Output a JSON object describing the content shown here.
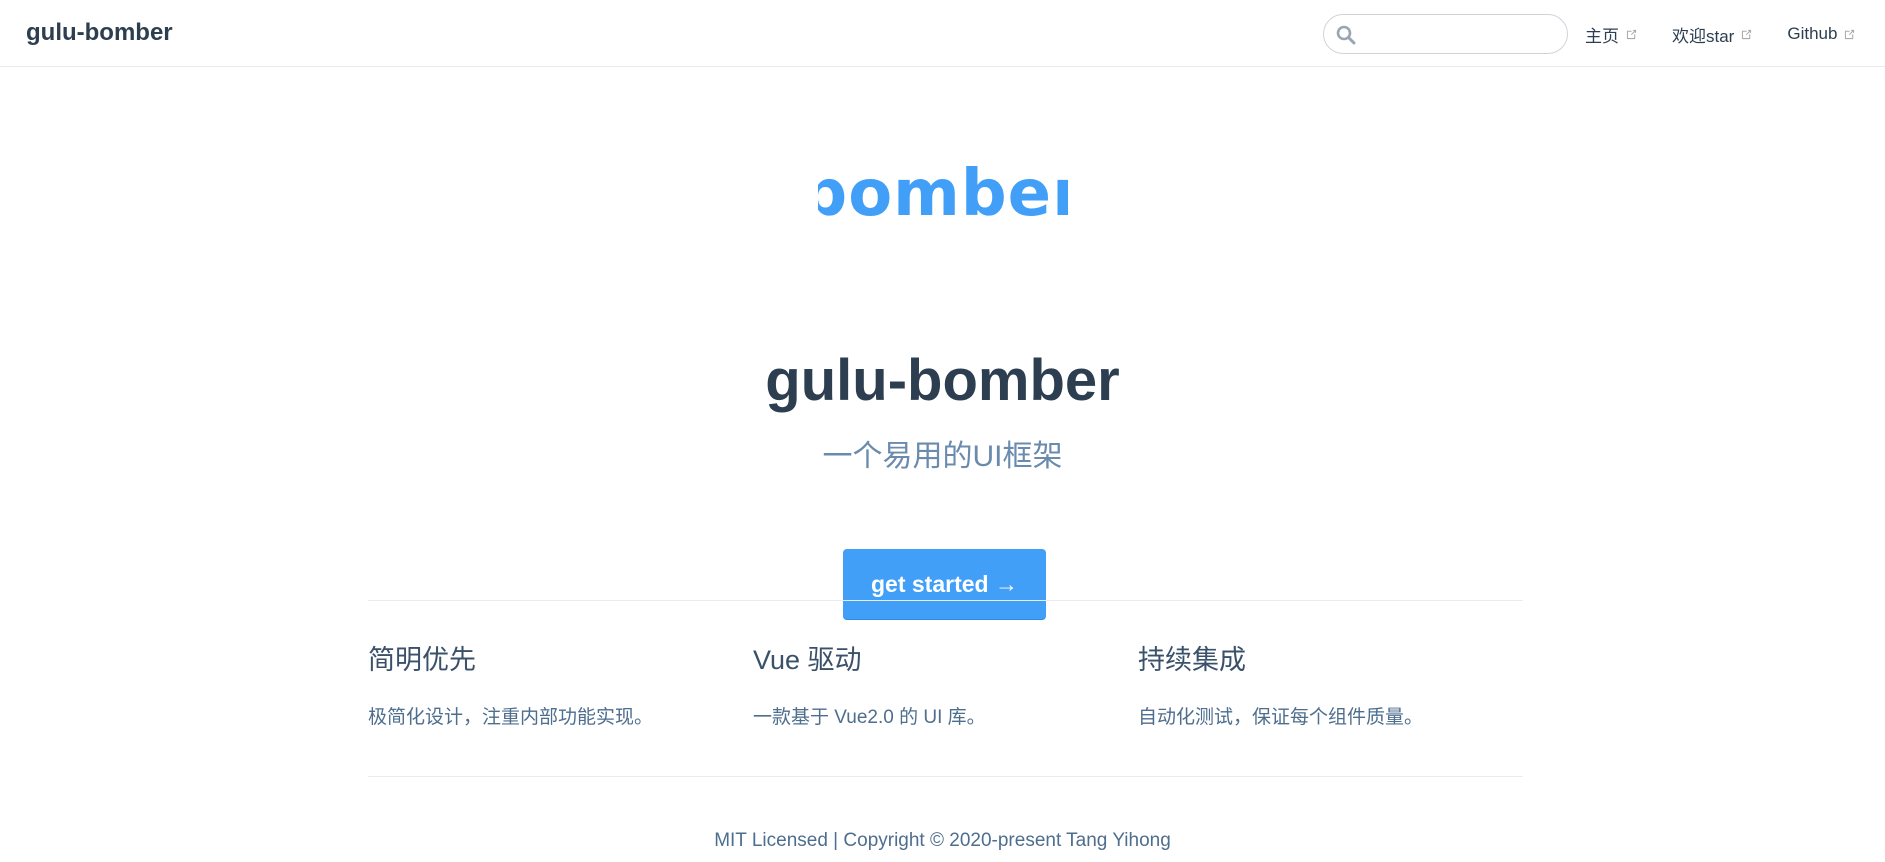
{
  "navbar": {
    "site_name": "gulu-bomber",
    "search": {
      "value": "",
      "placeholder": ""
    },
    "links": [
      {
        "label": "主页",
        "icon": "external-link-icon"
      },
      {
        "label": "欢迎star",
        "icon": "external-link-icon"
      },
      {
        "label": "Github",
        "icon": "external-link-icon"
      }
    ]
  },
  "hero": {
    "logo_text": "bomber",
    "title": "gulu-bomber",
    "description": "一个易用的UI框架",
    "action_label": "get started →"
  },
  "features": [
    {
      "title": "简明优先",
      "details": "极简化设计，注重内部功能实现。"
    },
    {
      "title": "Vue 驱动",
      "details": "一款基于 Vue2.0 的 UI 库。"
    },
    {
      "title": "持续集成",
      "details": "自动化测试，保证每个组件质量。"
    }
  ],
  "footer": {
    "text": "MIT Licensed | Copyright © 2020-present Tang Yihong"
  },
  "colors": {
    "accent": "#419ff8",
    "text": "#2c3e50",
    "muted": "#6a8bad",
    "border": "#eaecef"
  }
}
